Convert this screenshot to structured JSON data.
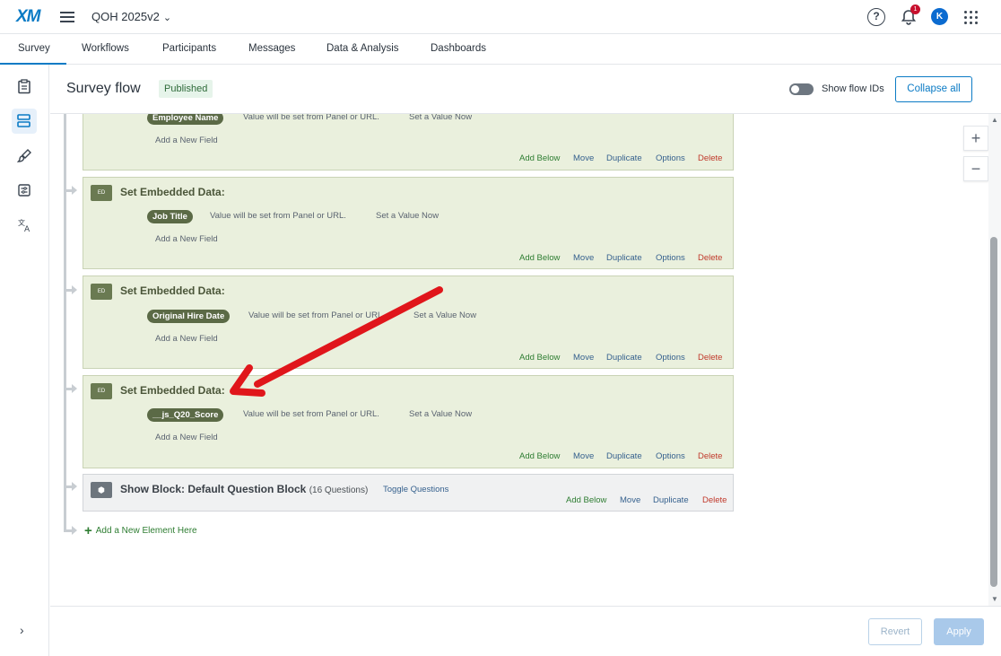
{
  "topbar": {
    "logo": "XM",
    "project_name": "QOH 2025v2",
    "help_glyph": "?",
    "notification_count": "1",
    "avatar_initial": "K"
  },
  "tabs": [
    "Survey",
    "Workflows",
    "Participants",
    "Messages",
    "Data & Analysis",
    "Dashboards"
  ],
  "page": {
    "title": "Survey flow",
    "status": "Published",
    "show_flow_ids_label": "Show flow IDs",
    "collapse_all_label": "Collapse all"
  },
  "flow": {
    "partial_card": {
      "field": "Employee Name",
      "field_text": "Value will be set from Panel or URL.",
      "set_value": "Set a Value Now",
      "add_field": "Add a New Field"
    },
    "embedded_cards": [
      {
        "title": "Set Embedded Data:",
        "field": "Job Title",
        "field_text": "Value will be set from Panel or URL.",
        "set_value": "Set a Value Now",
        "add_field": "Add a New Field"
      },
      {
        "title": "Set Embedded Data:",
        "field": "Original Hire Date",
        "field_text": "Value will be set from Panel or URL.",
        "set_value": "Set a Value Now",
        "add_field": "Add a New Field"
      },
      {
        "title": "Set Embedded Data:",
        "field": "__js_Q20_Score",
        "field_text": "Value will be set from Panel or URL.",
        "set_value": "Set a Value Now",
        "add_field": "Add a New Field"
      }
    ],
    "embedded_icon_label": "ED",
    "block_card": {
      "title": "Show Block: Default Question Block",
      "count": "(16 Questions)",
      "toggle": "Toggle Questions"
    },
    "actions": {
      "add_below": "Add Below",
      "move": "Move",
      "duplicate": "Duplicate",
      "options": "Options",
      "delete": "Delete"
    },
    "add_new_element": "Add a New Element Here"
  },
  "zoom": {
    "in": "+",
    "out": "−"
  },
  "footer": {
    "revert": "Revert",
    "apply": "Apply"
  },
  "sidebar": [
    "survey-icon",
    "flow-icon",
    "brush-icon",
    "options-icon",
    "translate-icon"
  ],
  "annotation": {
    "arrow_color": "#e0161b"
  }
}
